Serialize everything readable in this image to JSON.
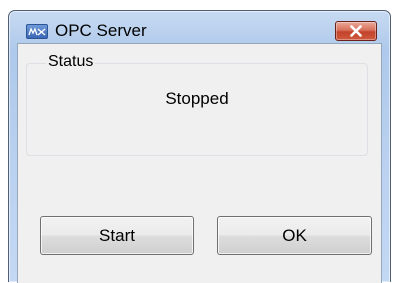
{
  "window": {
    "title": "OPC Server",
    "icon": "mx-app-icon",
    "close_icon": "close-icon"
  },
  "status_group": {
    "label": "Status",
    "value": "Stopped"
  },
  "buttons": {
    "start_label": "Start",
    "ok_label": "OK"
  },
  "colors": {
    "titlebar": "#b7cfee",
    "close_button": "#c4422c",
    "client_background": "#f0f0f0"
  }
}
